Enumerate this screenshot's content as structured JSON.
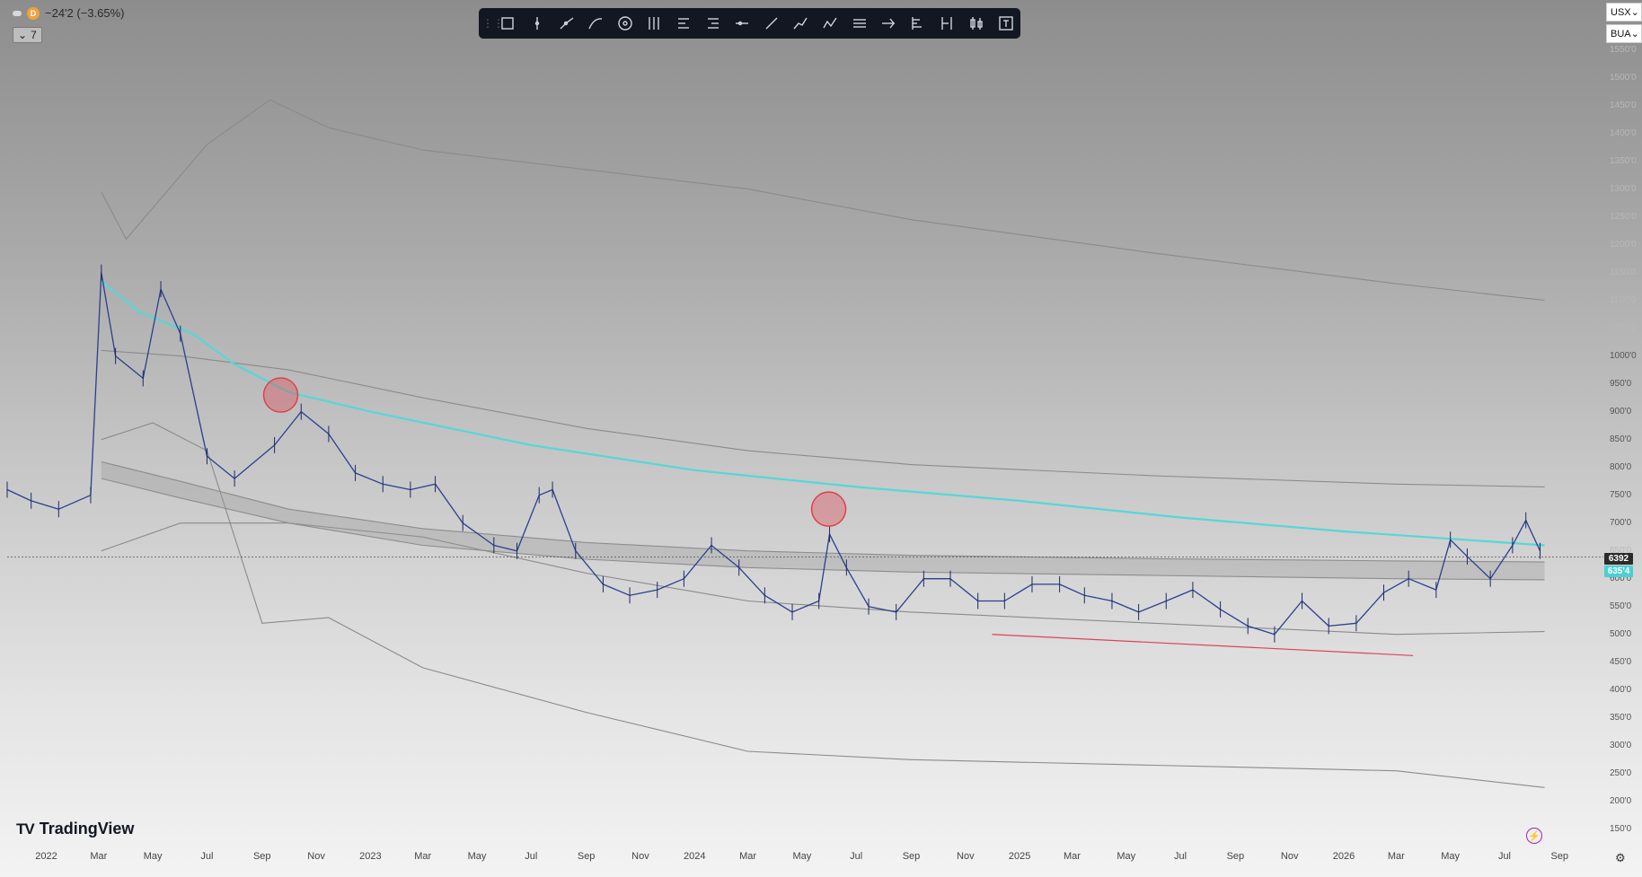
{
  "header": {
    "change_text": "−24'2 (−3.65%)",
    "badge_letter": "D",
    "indicator_count": "7"
  },
  "toolbar": {
    "tools": [
      "rectangle-icon",
      "vertical-line-icon",
      "path-icon",
      "curve-icon",
      "circle-icon",
      "pitchfork-icon",
      "long-position-icon",
      "short-position-icon",
      "horizontal-ray-icon",
      "trend-line-icon",
      "polyline-icon",
      "zigzag-icon",
      "parallel-lines-icon",
      "fib-retracement-icon",
      "volume-profile-icon",
      "fixed-range-icon",
      "candle-pattern-icon",
      "text-tool-icon"
    ]
  },
  "selectors": {
    "currency": "USX",
    "unit": "BUA"
  },
  "branding": {
    "logo_text": "TradingView"
  },
  "colors": {
    "accent": "#56d7d7",
    "band": "#8a8a8a",
    "price": "#2a3f8f",
    "marker": "#e0404a",
    "support_line": "#e0405a"
  },
  "chart_data": {
    "type": "line",
    "price_tags": {
      "last": "6392",
      "ma": "635'4"
    },
    "y_ticks": [
      "1550'0",
      "1500'0",
      "1450'0",
      "1400'0",
      "1350'0",
      "1300'0",
      "1250'0",
      "1200'0",
      "1150'0",
      "1100'0",
      "1050'0",
      "1000'0",
      "950'0",
      "900'0",
      "850'0",
      "800'0",
      "750'0",
      "700'0",
      "650'0",
      "600'0",
      "550'0",
      "500'0",
      "450'0",
      "400'0",
      "350'0",
      "300'0",
      "250'0",
      "200'0",
      "150'0"
    ],
    "y_visible_labels": [
      "1000'0",
      "950'0",
      "900'0",
      "850'0",
      "800'0",
      "750'0",
      "700'0",
      "600'0",
      "550'0",
      "500'0",
      "450'0",
      "400'0",
      "350'0",
      "300'0",
      "250'0",
      "200'0",
      "150'0"
    ],
    "x_ticks": [
      "2022",
      "Mar",
      "May",
      "Jul",
      "Sep",
      "Nov",
      "2023",
      "Mar",
      "May",
      "Jul",
      "Sep",
      "Nov",
      "2024",
      "Mar",
      "May",
      "Jul",
      "Sep",
      "Nov",
      "2025",
      "Mar",
      "May",
      "Jul",
      "Sep",
      "Nov",
      "2026",
      "Mar",
      "May",
      "Jul",
      "Sep"
    ],
    "ylim": [
      140,
      1575
    ],
    "xlim": [
      "2021-11-18",
      "2026-09-25"
    ],
    "series": [
      {
        "role": "upper-band-2",
        "x": [
          "2022-03-04",
          "2022-04-01",
          "2022-07-01",
          "2022-09-10",
          "2022-11-15",
          "2023-03-01",
          "2023-09-01",
          "2024-03-01",
          "2024-09-01",
          "2025-06-01",
          "2026-03-01",
          "2026-08-15"
        ],
        "y": [
          1295,
          1210,
          1380,
          1460,
          1410,
          1370,
          1335,
          1300,
          1245,
          1185,
          1130,
          1100
        ]
      },
      {
        "role": "upper-band-1",
        "x": [
          "2022-03-04",
          "2022-06-01",
          "2022-10-01",
          "2023-03-01",
          "2023-09-01",
          "2024-03-01",
          "2024-09-01",
          "2025-06-01",
          "2026-03-01",
          "2026-08-15"
        ],
        "y": [
          1010,
          1000,
          975,
          925,
          870,
          830,
          805,
          785,
          770,
          765
        ]
      },
      {
        "role": "inner-upper",
        "x": [
          "2022-03-04",
          "2022-06-01",
          "2022-10-01",
          "2023-03-01",
          "2023-09-01",
          "2024-03-01",
          "2024-09-01",
          "2025-06-01",
          "2026-03-01",
          "2026-08-15"
        ],
        "y": [
          810,
          775,
          725,
          690,
          665,
          650,
          642,
          636,
          632,
          630
        ]
      },
      {
        "role": "moving-average",
        "x": [
          "2022-03-04",
          "2022-04-15",
          "2022-05-15",
          "2022-06-15",
          "2022-08-01",
          "2022-10-01",
          "2023-01-01",
          "2023-07-01",
          "2024-01-01",
          "2024-07-01",
          "2025-01-01",
          "2025-07-01",
          "2026-01-01",
          "2026-08-15"
        ],
        "y": [
          1135,
          1080,
          1060,
          1040,
          985,
          935,
          900,
          840,
          795,
          765,
          740,
          710,
          685,
          660
        ]
      },
      {
        "role": "inner-lower",
        "x": [
          "2022-03-04",
          "2022-06-01",
          "2022-10-01",
          "2023-03-01",
          "2023-09-01",
          "2024-03-01",
          "2024-09-01",
          "2025-06-01",
          "2026-03-01",
          "2026-08-15"
        ],
        "y": [
          780,
          745,
          700,
          660,
          635,
          620,
          612,
          606,
          600,
          598
        ]
      },
      {
        "role": "lower-band-1",
        "x": [
          "2022-03-04",
          "2022-06-01",
          "2022-10-01",
          "2023-03-01",
          "2023-09-01",
          "2024-03-01",
          "2024-09-01",
          "2025-06-01",
          "2026-03-01",
          "2026-08-15"
        ],
        "y": [
          650,
          700,
          700,
          675,
          610,
          560,
          540,
          520,
          500,
          505
        ]
      },
      {
        "role": "lower-band-2",
        "x": [
          "2022-03-04",
          "2022-05-01",
          "2022-07-01",
          "2022-09-01",
          "2022-11-15",
          "2023-03-01",
          "2023-09-01",
          "2024-03-01",
          "2024-09-01",
          "2025-06-01",
          "2026-03-01",
          "2026-08-15"
        ],
        "y": [
          850,
          880,
          830,
          520,
          530,
          440,
          360,
          290,
          275,
          265,
          255,
          225
        ]
      },
      {
        "role": "price",
        "x": [
          "2021-11-18",
          "2021-12-15",
          "2022-01-15",
          "2022-02-20",
          "2022-03-04",
          "2022-03-20",
          "2022-04-20",
          "2022-05-10",
          "2022-06-01",
          "2022-07-01",
          "2022-08-01",
          "2022-09-15",
          "2022-10-15",
          "2022-11-15",
          "2022-12-15",
          "2023-01-15",
          "2023-02-15",
          "2023-03-15",
          "2023-04-15",
          "2023-05-20",
          "2023-06-15",
          "2023-07-10",
          "2023-07-25",
          "2023-08-20",
          "2023-09-20",
          "2023-10-20",
          "2023-11-20",
          "2023-12-20",
          "2024-01-20",
          "2024-02-20",
          "2024-03-20",
          "2024-04-20",
          "2024-05-20",
          "2024-06-01",
          "2024-06-20",
          "2024-07-15",
          "2024-08-15",
          "2024-09-15",
          "2024-10-15",
          "2024-11-15",
          "2024-12-15",
          "2025-01-15",
          "2025-02-15",
          "2025-03-15",
          "2025-04-15",
          "2025-05-15",
          "2025-06-15",
          "2025-07-15",
          "2025-08-15",
          "2025-09-15",
          "2025-10-15",
          "2025-11-15",
          "2025-12-15",
          "2026-01-15",
          "2026-02-15",
          "2026-03-15",
          "2026-04-15",
          "2026-05-01",
          "2026-05-20",
          "2026-06-15",
          "2026-07-10",
          "2026-07-25",
          "2026-08-10"
        ],
        "y": [
          760,
          740,
          725,
          750,
          1150,
          1000,
          960,
          1120,
          1040,
          820,
          780,
          840,
          900,
          860,
          790,
          770,
          760,
          770,
          700,
          660,
          650,
          750,
          760,
          650,
          590,
          570,
          580,
          600,
          660,
          620,
          570,
          540,
          560,
          680,
          620,
          550,
          540,
          600,
          600,
          560,
          560,
          590,
          590,
          570,
          560,
          540,
          560,
          580,
          545,
          515,
          500,
          560,
          515,
          520,
          575,
          600,
          580,
          670,
          640,
          600,
          660,
          705,
          650
        ]
      }
    ],
    "annotations": {
      "markers": [
        {
          "x": "2022-09-22",
          "y": 930
        },
        {
          "x": "2024-05-31",
          "y": 725
        }
      ],
      "support_line": {
        "x": [
          "2024-12-01",
          "2026-03-20"
        ],
        "y": [
          500,
          462
        ]
      },
      "last_price_level": 639
    }
  }
}
